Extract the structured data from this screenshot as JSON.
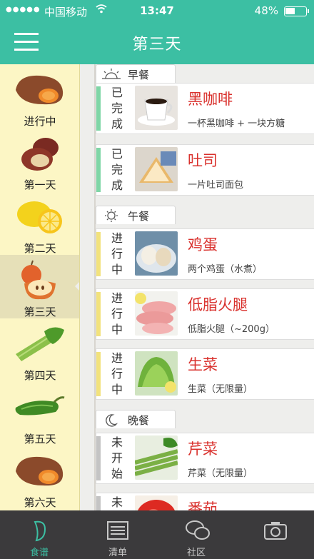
{
  "status_bar": {
    "signal": "●●●●●",
    "carrier": "中国移动",
    "time": "13:47",
    "battery_percent": "48%",
    "battery_level": 0.48
  },
  "header": {
    "title": "第三天",
    "menu_icon": "hamburger-menu-icon"
  },
  "sidebar": {
    "days": [
      {
        "label": "进行中",
        "icon": "sweet-potato-icon",
        "active": false
      },
      {
        "label": "第一天",
        "icon": "red-potato-icon",
        "active": false
      },
      {
        "label": "第二天",
        "icon": "lemon-icon",
        "active": false
      },
      {
        "label": "第三天",
        "icon": "apple-icon",
        "active": true
      },
      {
        "label": "第四天",
        "icon": "celery-icon",
        "active": false
      },
      {
        "label": "第五天",
        "icon": "green-pepper-icon",
        "active": false
      },
      {
        "label": "第六天",
        "icon": "sweet-potato-icon",
        "active": false
      }
    ]
  },
  "meals": [
    {
      "title": "早餐",
      "icon": "sunrise-icon",
      "items": [
        {
          "status": "已完成",
          "status_color": "#7fd6a6",
          "name": "黑咖啡",
          "desc": "一杯黑咖啡 + 一块方糖",
          "image": "coffee-thumb"
        },
        {
          "status": "已完成",
          "status_color": "#7fd6a6",
          "name": "吐司",
          "desc": "一片吐司面包",
          "image": "toast-thumb"
        }
      ]
    },
    {
      "title": "午餐",
      "icon": "sun-icon",
      "items": [
        {
          "status": "进行中",
          "status_color": "#f2e27c",
          "name": "鸡蛋",
          "desc": "两个鸡蛋（水煮）",
          "image": "egg-thumb"
        },
        {
          "status": "进行中",
          "status_color": "#f2e27c",
          "name": "低脂火腿",
          "desc": "低脂火腿（~200g）",
          "image": "ham-thumb"
        },
        {
          "status": "进行中",
          "status_color": "#f2e27c",
          "name": "生菜",
          "desc": "生菜（无限量）",
          "image": "lettuce-thumb"
        }
      ]
    },
    {
      "title": "晚餐",
      "icon": "moon-icon",
      "items": [
        {
          "status": "未开始",
          "status_color": "#c4c4c4",
          "name": "芹菜",
          "desc": "芹菜（无限量）",
          "image": "celery-thumb"
        },
        {
          "status": "未开始",
          "status_color": "#c4c4c4",
          "name": "番茄",
          "desc": "",
          "image": "tomato-thumb"
        }
      ]
    }
  ],
  "tabbar": {
    "tabs": [
      {
        "label": "食谱",
        "icon": "recipe-icon",
        "active": true
      },
      {
        "label": "清单",
        "icon": "list-icon",
        "active": false
      },
      {
        "label": "社区",
        "icon": "chat-bubbles-icon",
        "active": false
      },
      {
        "label": "",
        "icon": "camera-icon",
        "active": false
      }
    ]
  },
  "colors": {
    "brand": "#3cbfa3",
    "done": "#7fd6a6",
    "in_progress": "#f2e27c",
    "not_started": "#c4c4c4",
    "food_name": "#d9302c"
  }
}
